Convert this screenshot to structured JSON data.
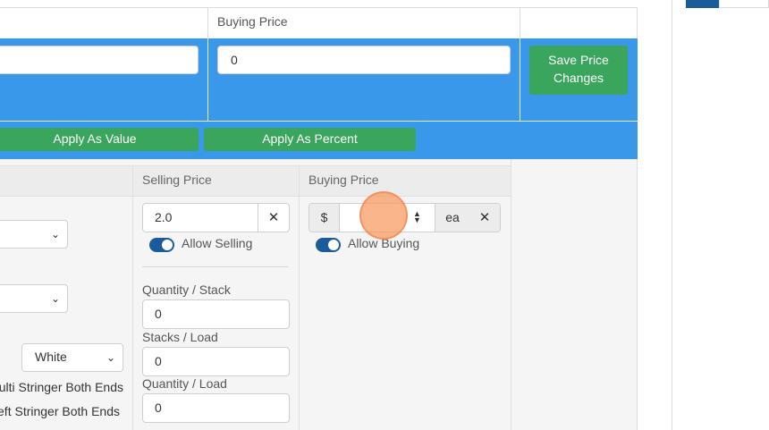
{
  "header": {
    "buying_price_label": "Buying Price"
  },
  "top_row": {
    "left_input_value": "",
    "buying_price_value": "0",
    "save_button_label": "Save Price Changes"
  },
  "apply": {
    "value_label": "Apply As Value",
    "percent_label": "Apply As Percent"
  },
  "columns": {
    "selling_price": "Selling Price",
    "buying_price": "Buying Price"
  },
  "selling": {
    "price_value": "2.0",
    "clear_glyph": "✕",
    "allow_label": "Allow Selling",
    "qty_stack_label": "Quantity / Stack",
    "qty_stack_value": "0",
    "stacks_load_label": "Stacks / Load",
    "stacks_load_value": "0",
    "qty_load_label": "Quantity / Load",
    "qty_load_value": "0"
  },
  "buying": {
    "currency": "$",
    "price_value": "",
    "unit": "ea",
    "clear_glyph": "✕",
    "allow_label": "Allow Buying"
  },
  "left_col": {
    "select1_value": "",
    "select2_value": "",
    "color_value": "White",
    "multi_stringer": "Multi Stringer Both Ends",
    "left_stringer": "Left Stringer Both Ends"
  },
  "icons": {
    "chevron": "chevron-down-icon",
    "spinner": "spinner-arrows-icon",
    "close": "close-icon"
  },
  "colors": {
    "accent_blue": "#3a98ea",
    "green": "#3aa55c",
    "toggle": "#1a5c9a"
  }
}
